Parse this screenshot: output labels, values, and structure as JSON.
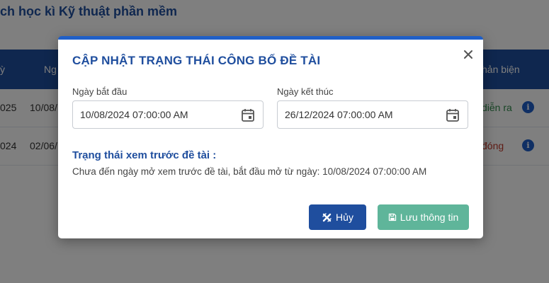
{
  "background": {
    "page_title": "ch học kì Kỹ thuật phần mềm",
    "table_headers": [
      "ỳ",
      "Ng",
      "hản biện"
    ],
    "rows": [
      {
        "col1": "025",
        "col2": "10/08/",
        "status": "diễn ra",
        "status_color": "#2f8a4a"
      },
      {
        "col1": "024",
        "col2": "02/06/",
        "status": "đóng",
        "status_color": "#c0392b"
      }
    ],
    "info_icon": "info-icon"
  },
  "modal": {
    "title": "CẬP NHẬT TRẠNG THÁI CÔNG BỐ ĐỀ TÀI",
    "close_icon": "close-icon",
    "start_date": {
      "label": "Ngày bắt đầu",
      "value": "10/08/2024 07:00:00 AM",
      "icon": "calendar-icon"
    },
    "end_date": {
      "label": "Ngày kết thúc",
      "value": "26/12/2024 07:00:00 AM",
      "icon": "calendar-icon"
    },
    "preview": {
      "heading": "Trạng thái xem trước đề tài :",
      "text": "Chưa đến ngày mở xem trước đề tài, bắt đầu mở từ ngày: 10/08/2024 07:00:00 AM"
    },
    "buttons": {
      "cancel_label": "Hủy",
      "cancel_icon": "cross-icon",
      "save_label": "Lưu thông tin",
      "save_icon": "save-icon"
    }
  },
  "colors": {
    "primary": "#1f4e9e",
    "accent_border": "#1f5fc8",
    "save_button": "#5fb59a",
    "overlay": "rgba(0,0,0,0.5)"
  }
}
